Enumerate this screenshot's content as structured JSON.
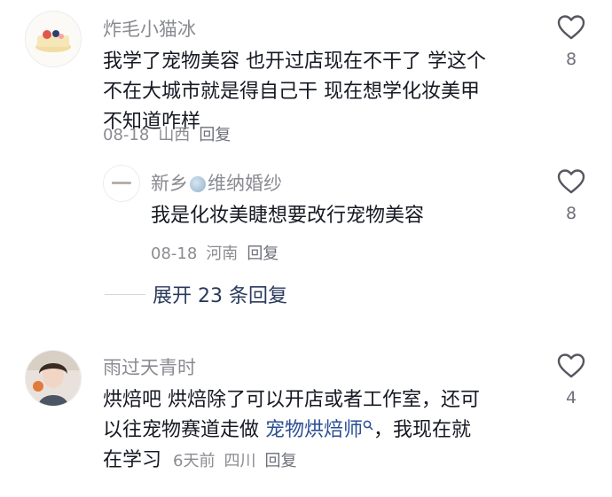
{
  "comments": [
    {
      "username": "炸毛小猫冰",
      "lines": [
        "我学了宠物美容 也开过店现在不干了 学这个",
        "不在大城市就是得自己干 现在想学化妆美甲",
        "不知道咋样"
      ],
      "date": "08-18",
      "location": "山西",
      "reply_label": "回复",
      "likes": "8",
      "reply": {
        "username_prefix": "新乡",
        "username_suffix": "维纳婚纱",
        "text": "我是化妆美睫想要改行宠物美容",
        "date": "08-18",
        "location": "河南",
        "reply_label": "回复",
        "likes": "8"
      },
      "expand_label": "展开 23 条回复"
    },
    {
      "username": "雨过天青时",
      "line1": "烘焙吧 烘焙除了可以开店或者工作室，还可",
      "line2_pre": "以往宠物赛道走做",
      "line2_link": "宠物烘焙师",
      "line2_post": "，我现在就",
      "line3": "在学习",
      "date": "6天前",
      "location": "四川",
      "reply_label": "回复",
      "likes": "4"
    }
  ],
  "colors": {
    "text": "#161823",
    "secondary": "#8a8b91",
    "link": "#2b4f93"
  }
}
